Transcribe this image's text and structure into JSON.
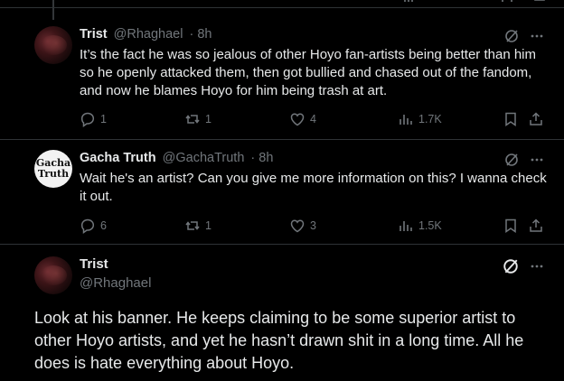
{
  "colors": {
    "background": "#000000",
    "text": "#e7e9ea",
    "muted": "#71767b",
    "divider": "#2f3336"
  },
  "tweets": [
    {
      "name": "Trist",
      "handle": "@Rhaghael",
      "time": "· 8h",
      "text": "It’s the fact he was so jealous of other Hoyo fan-artists being better than him so he openly attacked them, then got bullied and chased out of the fandom, and now he blames Hoyo for him being trash at art.",
      "replies": "1",
      "reposts": "1",
      "likes": "4",
      "views": "1.7K"
    },
    {
      "name": "Gacha Truth",
      "handle": "@GachaTruth",
      "time": "· 8h",
      "avatar_text": [
        "Gacha",
        "Truth"
      ],
      "text": "Wait he's an artist? Can you give me more information on this? I wanna check it out.",
      "replies": "6",
      "reposts": "1",
      "likes": "3",
      "views": "1.5K"
    }
  ],
  "main_tweet": {
    "name": "Trist",
    "handle": "@Rhaghael",
    "text": "Look at his banner. He keeps claiming to be some superior artist to other Hoyo artists, and yet he hasn’t drawn shit in a long time. All he does is hate everything about Hoyo."
  },
  "icons": [
    "reply-icon",
    "repost-icon",
    "like-icon",
    "views-icon",
    "bookmark-icon",
    "share-icon",
    "grok-icon",
    "more-icon"
  ]
}
